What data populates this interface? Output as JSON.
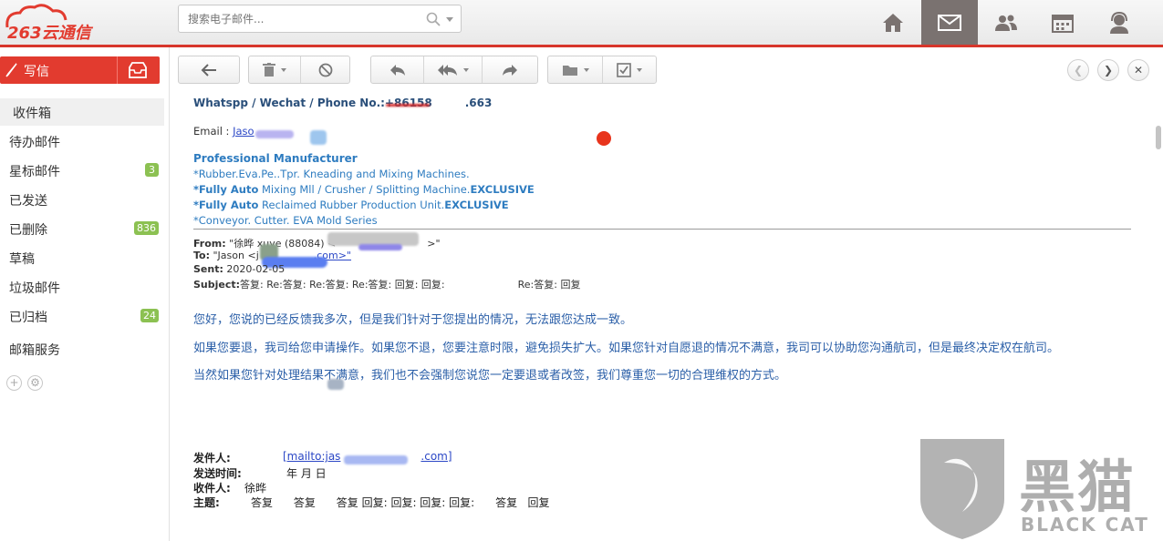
{
  "topbar": {
    "logo_text": "263云通信",
    "search_placeholder": "搜索电子邮件...",
    "nav_icons": [
      "home-icon",
      "mail-icon",
      "contacts-icon",
      "calendar-icon",
      "support-icon"
    ]
  },
  "sidebar": {
    "compose_label": "写信",
    "folders": [
      {
        "label": "收件箱",
        "badge": ""
      },
      {
        "label": "待办邮件",
        "badge": ""
      },
      {
        "label": "星标邮件",
        "badge": "3"
      },
      {
        "label": "已发送",
        "badge": ""
      },
      {
        "label": "已删除",
        "badge": "836"
      },
      {
        "label": "草稿",
        "badge": ""
      },
      {
        "label": "垃圾邮件",
        "badge": ""
      },
      {
        "label": "已归档",
        "badge": "24"
      },
      {
        "label": "邮箱服务",
        "badge": ""
      }
    ]
  },
  "toolbar": {
    "buttons": [
      "back-icon",
      "delete-icon",
      "block-icon",
      "reply-icon",
      "reply-all-icon",
      "forward-icon",
      "move-folder-icon",
      "mark-icon"
    ]
  },
  "mail": {
    "phone_line": "Whatspp / Wechat / Phone No.:+86158",
    "phone_tail": ".663",
    "email_label": "Email : ",
    "email_link": "Jaso",
    "sig_title": "Professional Manufacturer",
    "sig_line1": "*Rubber.Eva.Pe..Tpr. Kneading and Mixing Machines.",
    "sig_line2_bold": "*Fully Auto",
    "sig_line2_rest": " Mixing Mll / Crusher / Splitting Machine.",
    "sig_line2_excl": "EXCLUSIVE",
    "sig_line3_bold": "*Fully Auto",
    "sig_line3_rest": " Reclaimed Rubber Production Unit.",
    "sig_line3_excl": "EXCLUSIVE",
    "sig_line4": "*Conveyor. Cutter. EVA Mold Series",
    "from_label": "From:",
    "from_value": "\"徐晔 xuye (88084) <",
    "from_tail": ">\"",
    "to_label": "To:",
    "to_value": "\"Jason <j",
    "to_tail": ".com>\"",
    "sent_label": "Sent:",
    "sent_value": "2020-02-05",
    "subject_label": "Subject:",
    "subject_value": "答复: Re:答复: Re:答复: Re:答复: 回复: 回复:",
    "subject_tail": "Re:答复: 回复",
    "body_line1": "您好，您说的已经反馈我多次，但是我们针对于您提出的情况，无法跟您达成一致。",
    "body_line2": "如果您要退，我司给您申请操作。如果您不退，您要注意时限，避免损失扩大。如果您针对自愿退的情况不满意，我司可以协助您沟通航司，但是最终决定权在航司。",
    "body_line3": "当然如果您针对处理结果不满意，我们也不会强制您说您一定要退或者改签，我们尊重您一切的合理维权的方式。",
    "q_sender_label": "发件人:",
    "q_sender_link": "[mailto:jas",
    "q_sender_tail": ".com]",
    "q_time_label": "发送时间:",
    "q_time_value": "年 月 日",
    "q_to_label": "收件人:",
    "q_to_value": "徐晔",
    "q_subject_label": "主题:",
    "q_subject_value": "答复      答复      答复 回复: 回复: 回复: 回复:      答复   回复"
  },
  "watermark": {
    "cn": "黑猫",
    "en": "BLACK CAT"
  },
  "colors": {
    "accent": "#e23b2f",
    "link": "#2b47c6",
    "signature": "#2e7cc0",
    "body_text": "#2b5fa8",
    "badge": "#8cc152"
  }
}
